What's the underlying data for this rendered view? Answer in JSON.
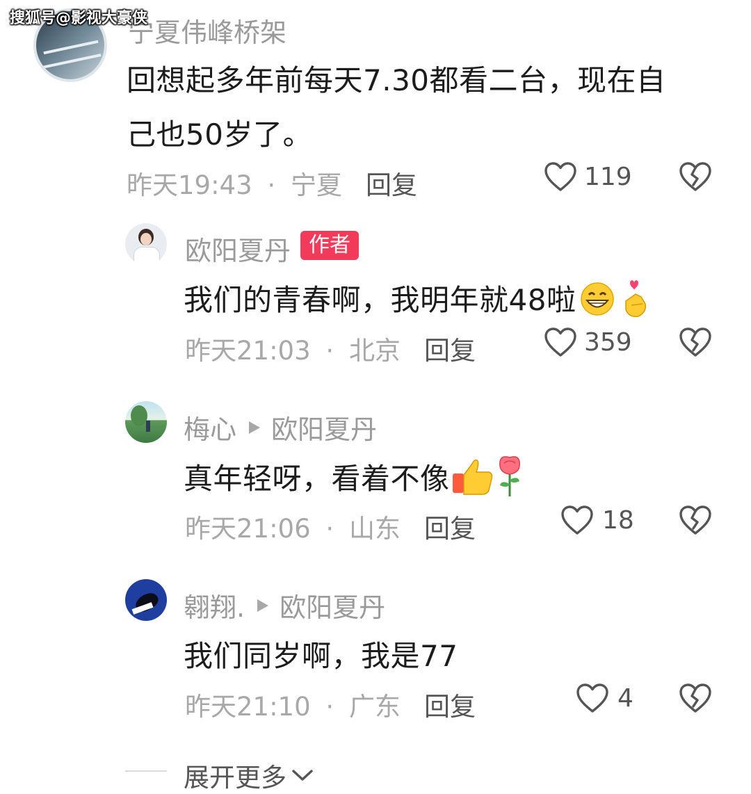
{
  "watermark": "搜狐号@影视大豪侠",
  "comments": [
    {
      "author": "宁夏伟峰桥架",
      "content_lines": [
        "回想起多年前每天7.30都看二台，现在自",
        "己也50岁了。"
      ],
      "time": "昨天19:43",
      "location": "宁夏",
      "reply_label": "回复",
      "likes": "119"
    },
    {
      "author": "欧阳夏丹",
      "badge": "作者",
      "content": "我们的青春啊，我明年就48啦",
      "time": "昨天21:03",
      "location": "北京",
      "reply_label": "回复",
      "likes": "359"
    },
    {
      "author": "梅心",
      "reply_to": "欧阳夏丹",
      "content": "真年轻呀，看着不像",
      "time": "昨天21:06",
      "location": "山东",
      "reply_label": "回复",
      "likes": "18"
    },
    {
      "author": "翱翔.",
      "reply_to": "欧阳夏丹",
      "content": "我们同岁啊，我是77",
      "time": "昨天21:10",
      "location": "广东",
      "reply_label": "回复",
      "likes": "4"
    }
  ],
  "separator": "·",
  "expand_more": "展开更多",
  "icons": {
    "like": "heart-outline-icon",
    "dislike": "broken-heart-icon",
    "reply_arrow": "triangle-right-icon",
    "expand": "chevron-down-icon",
    "emoji_grin": "grinning-face-emoji",
    "emoji_finger_heart": "finger-heart-emoji",
    "emoji_thumbs": "thumbs-up-emoji",
    "emoji_rose": "rose-emoji"
  },
  "colors": {
    "badge": "#f23a5a",
    "meta_text": "#a8a8a8",
    "name_text": "#9a9a9a"
  }
}
